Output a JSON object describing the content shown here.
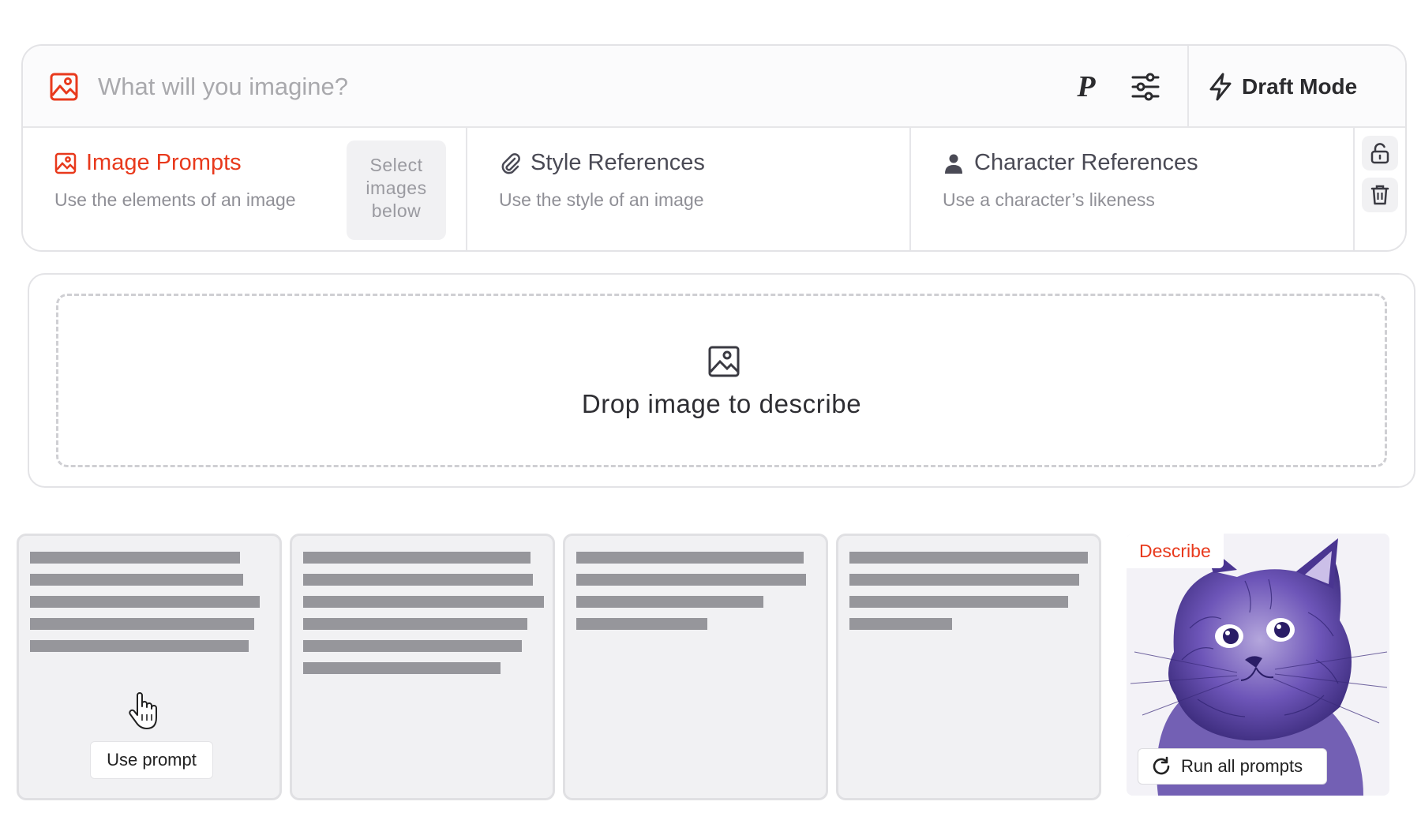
{
  "prompt_bar": {
    "placeholder": "What will you imagine?",
    "personalize_label": "P",
    "draft_mode_label": "Draft Mode"
  },
  "references": [
    {
      "title": "Image Prompts",
      "subtitle": "Use the elements of an image",
      "icon": "image-icon",
      "active": true
    },
    {
      "title": "Style References",
      "subtitle": "Use the style of an image",
      "icon": "paperclip-icon",
      "active": false
    },
    {
      "title": "Character References",
      "subtitle": "Use a character’s likeness",
      "icon": "person-icon",
      "active": false
    }
  ],
  "select_hint": [
    "Select",
    "images",
    "below"
  ],
  "drop_zone": {
    "label": "Drop image to describe"
  },
  "cards": {
    "use_prompt_label": "Use prompt",
    "line_counts": [
      5,
      6,
      4,
      4
    ]
  },
  "describe": {
    "tag_label": "Describe",
    "run_all_label": "Run all prompts"
  },
  "colors": {
    "accent": "#e8391c",
    "placeholder_bar": "#96969b",
    "card_bg": "#f1f1f3"
  }
}
